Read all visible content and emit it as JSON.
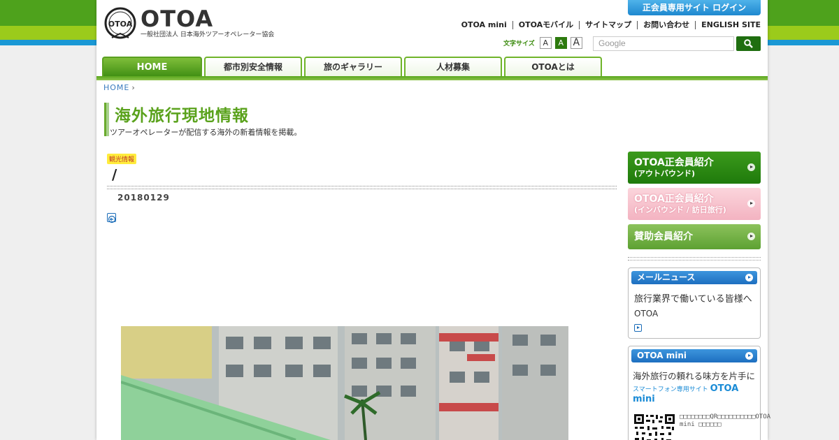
{
  "header": {
    "logo_title": "OTOA",
    "logo_subtitle": "一般社団法人 日本海外ツアーオペレーター協会",
    "login_label": "正会員専用サイト ログイン",
    "top_links": [
      "OTOA mini",
      "OTOAモバイル",
      "サイトマップ",
      "お問い合わせ",
      "ENGLISH SITE"
    ],
    "font_size_label": "文字サイズ",
    "font_size_options": [
      "A",
      "A",
      "A"
    ],
    "search_placeholder": "Google"
  },
  "nav": {
    "tabs": [
      "HOME",
      "都市別安全情報",
      "旅のギャラリー",
      "人材募集",
      "OTOAとは"
    ]
  },
  "breadcrumb": {
    "home": "HOME",
    "sep": "›"
  },
  "page_heading": {
    "title": "海外旅行現地情報",
    "subtitle": "ツアーオペレーターが配信する海外の新着情報を掲載。"
  },
  "article": {
    "tag": "観光情報",
    "title": "/",
    "date": "20180129"
  },
  "sidebar": {
    "btn1_main": "OTOA正会員紹介",
    "btn1_sub": "(アウトバウンド)",
    "btn2_main": "OTOA正会員紹介",
    "btn2_sub": "(インバウンド / 訪日旅行)",
    "btn3_main": "賛助会員紹介",
    "mail_head": "メールニュース",
    "mail_line1": "旅行業界で働いている皆様へ",
    "mail_line2": "OTOA",
    "mini_head": "OTOA mini",
    "mini_line1": "海外旅行の頼れる味方を片手に",
    "mini_line2_small": "スマートフォン専用サイト",
    "mini_line2_big": "OTOA mini",
    "mini_note": "□□□□□□□□QR□□□□□□□□□□OTOA mini □□□□□□"
  },
  "colors": {
    "brand_green": "#4ea21c",
    "accent_blue": "#1a98d5",
    "login_blue": "#1e88cf"
  }
}
